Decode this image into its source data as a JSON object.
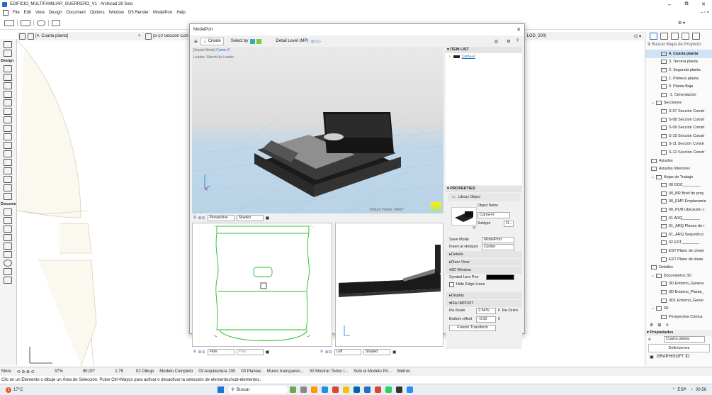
{
  "window": {
    "title": "EDIFICIO_MULTIFAMILIAR_GUERRERO_V1 - Archicad 28 Solo",
    "controls": [
      "–",
      "⧉",
      "✕"
    ]
  },
  "menu": [
    "File",
    "Edit",
    "View",
    "Design",
    "Document",
    "Options",
    "Window",
    "D5 Render",
    "ModelPort",
    "Help"
  ],
  "tabs": {
    "tab1": "[4. Cuarta planta]",
    "tab2": "[S-10 Sección Constru",
    "tab3": "LOD_200]",
    "close": "×"
  },
  "left_sections": {
    "design": "Design",
    "document": "Docume",
    "more": "More"
  },
  "dialog": {
    "title": "ModelPort",
    "close": "✕",
    "create_label": "Create",
    "select_by_label": "Select by",
    "detail_level_label": "Detail Level (MP)",
    "help": "?",
    "import_mode": "[Import Mode]",
    "import_item": "Cama+2",
    "loader": "Loader: SketchUp Loader",
    "trinum_label": "TriNum Visible:",
    "trinum_value": "54627",
    "view3d_toolbar": {
      "projection": "Perspective",
      "shading": "Shaded"
    },
    "plan_toolbar": {
      "floor1": "Floor",
      "floor2": "Floor"
    },
    "elev_toolbar": {
      "side": "Left",
      "shading": "Shaded"
    },
    "item_list": {
      "header": "ITEM LIST",
      "item": "Cama+2"
    },
    "properties": {
      "header": "PROPERTIES",
      "type": "Library Object",
      "object_name_label": "Object Name",
      "object_name_value": "Cama+2",
      "subtype_label": "Subtype",
      "subtype_value": "O...",
      "save_mode_label": "Save Mode",
      "save_mode_value": "ModelPort",
      "insert_label": "Insert at Hotspot",
      "insert_value": "Center",
      "details": "Details",
      "floor_view": "Floor View",
      "window3d": "3D Window",
      "symbol_line_pen": "Symbol Line Pen",
      "hide_edge_lines": "Hide Edge Lines",
      "display": "Display",
      "file_import": "File IMPORT",
      "rescale_label": "Re-Scale",
      "rescale_value": "2.54%",
      "reorient": "Re-Orien",
      "bottom_offset_label": "Bottom offset",
      "bottom_offset_value": "-0.00",
      "freeze": "Freeze Transform"
    }
  },
  "navigator": {
    "search_placeholder": "Buscar Mapa de Proyecto",
    "items": [
      {
        "label": "4. Cuarta planta",
        "indent": 2,
        "selected": true
      },
      {
        "label": "3. Tercera planta",
        "indent": 2
      },
      {
        "label": "2. Segunda planta",
        "indent": 2
      },
      {
        "label": "1. Primera planta",
        "indent": 2
      },
      {
        "label": "0. Planta Baja",
        "indent": 2
      },
      {
        "label": "-1. Cimentación",
        "indent": 2
      },
      {
        "label": "Secciones",
        "indent": 1,
        "folder": true
      },
      {
        "label": "S-07 Sección Constr",
        "indent": 2
      },
      {
        "label": "S-08 Sección Constr",
        "indent": 2
      },
      {
        "label": "S-09 Sección Constr",
        "indent": 2
      },
      {
        "label": "S-10 Sección Constr",
        "indent": 2
      },
      {
        "label": "S-11 Sección Constr",
        "indent": 2
      },
      {
        "label": "S-12 Sección Constr",
        "indent": 2
      },
      {
        "label": "Alzados",
        "indent": 1
      },
      {
        "label": "Alzados Interiores",
        "indent": 1
      },
      {
        "label": "Hojas de Trabajo",
        "indent": 1,
        "folder": true
      },
      {
        "label": "00 DOC________",
        "indent": 2
      },
      {
        "label": "00_BR Brief de proy",
        "indent": 2
      },
      {
        "label": "00_EMP Emplazamie",
        "indent": 2
      },
      {
        "label": "00_PUB Ubicación c",
        "indent": 2
      },
      {
        "label": "01 ARQ________",
        "indent": 2
      },
      {
        "label": "01_ARQ Planos de r",
        "indent": 2
      },
      {
        "label": "01_ARQ Segundo p",
        "indent": 2
      },
      {
        "label": "02 EST________",
        "indent": 2
      },
      {
        "label": "EST Plano de cimen",
        "indent": 2
      },
      {
        "label": "EST Plano de losas",
        "indent": 2
      },
      {
        "label": "Detalles",
        "indent": 1
      },
      {
        "label": "Documentos 3D",
        "indent": 1,
        "folder": true
      },
      {
        "label": "3D Entorno_Genera",
        "indent": 2
      },
      {
        "label": "3D Entorno_Planta_",
        "indent": 2
      },
      {
        "label": "3D1 Entorno_Gener",
        "indent": 2
      },
      {
        "label": "3D",
        "indent": 1,
        "folder": true
      },
      {
        "label": "Perspectiva Cónica",
        "indent": 2
      }
    ],
    "propiedades_header": "Propiedades",
    "prop_item_num": "4.",
    "prop_item_name": "Cuarta planta",
    "definiciones": "Definiciones",
    "graphisoft": "GRAPHISOFT ID"
  },
  "statusbar": {
    "more": "More",
    "zoom": "37%",
    "angle": "90,00°",
    "scale": "1:75",
    "layer_combo": "02 Dibujo",
    "model_view": "Modelo Completo",
    "pen_set": "03 Arquitectura 100",
    "dimension": "03 Plantas",
    "partial_struct": "Muros transparen...",
    "graphic_override": "00 Mostrar Todos l...",
    "renovation": "Solo el Modelo Pri...",
    "units": "Metros"
  },
  "hint": "Clic en un Elemento o dibuje un Área de Selección. Pulse Ctrl+Mayús para activar o desactivar la selección de elementos/sub-elementos.",
  "taskbar": {
    "weather": "17°C",
    "search": "Buscar",
    "lang": "ESP",
    "time": "00:56",
    "badge": "3"
  },
  "colors": {
    "accent": "#1a73e8",
    "plan_green": "#1fbf1f",
    "canvas_line": "#d8d2b4",
    "selected_nav": "#cfe3f7"
  }
}
